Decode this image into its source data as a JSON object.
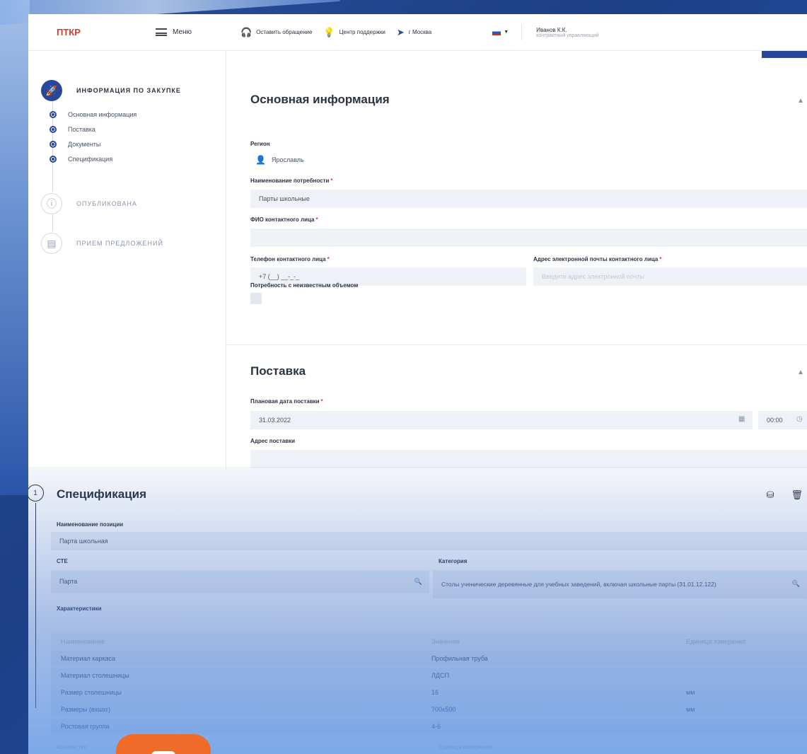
{
  "header": {
    "logo": "ПТКР",
    "menu_label": "Меню",
    "appeal": "Оставить обращение",
    "support": "Центр поддержки",
    "location": "г Москва",
    "user_name": "Иванов К.К.",
    "user_role": "контрактный управляющий"
  },
  "sidebar": {
    "step1": "ИНФОРМАЦИЯ ПО ЗАКУПКЕ",
    "subitems": [
      "Основная информация",
      "Поставка",
      "Документы",
      "Спецификация"
    ],
    "step2": "ОПУБЛИКОВАНА",
    "step3": "ПРИЕМ ПРЕДЛОЖЕНИЙ"
  },
  "main_info": {
    "title": "Основная информация",
    "region_label": "Регион",
    "region_value": "Ярославль",
    "need_name_label": "Наименование потребности",
    "need_name_value": "Парты школьные",
    "contact_label": "ФИО контактного лица",
    "phone_label": "Телефон контактного лица",
    "phone_value": "+7 (__) __-_-_",
    "email_label": "Адрес электронной почты контактного лица",
    "email_placeholder": "Введите адрес электронной почты",
    "unknown_volume_label": "Потребность с неизвестным объемом"
  },
  "delivery": {
    "title": "Поставка",
    "date_label": "Плановая дата поставки",
    "date_value": "31.03.2022",
    "time_value": "00:00",
    "address_label": "Адрес поставки"
  },
  "spec": {
    "number": "1",
    "title": "Спецификация",
    "position_label": "Наименование позиции",
    "position_value": "Парта школьная",
    "cte_label": "СТЕ",
    "cte_value": "Парта",
    "category_label": "Категория",
    "category_value": "Столы ученические деревянные для учебных заведений, включая школьные парты (31.01.12.122)",
    "chars_label": "Характеристики",
    "table_headers": [
      "Наименование",
      "Значение",
      "Единица измерения"
    ],
    "rows": [
      {
        "name": "Материал каркаса",
        "value": "Профильная труба",
        "unit": ""
      },
      {
        "name": "Материал столешницы",
        "value": "ЛДСП",
        "unit": ""
      },
      {
        "name": "Размер столешницы",
        "value": "16",
        "unit": "мм"
      },
      {
        "name": "Размеры (вхшхг)",
        "value": "700х500",
        "unit": "мм"
      },
      {
        "name": "Ростовая группа",
        "value": "4-6",
        "unit": ""
      }
    ],
    "quantity_label": "Количество",
    "unit_label": "Единица измерения"
  }
}
